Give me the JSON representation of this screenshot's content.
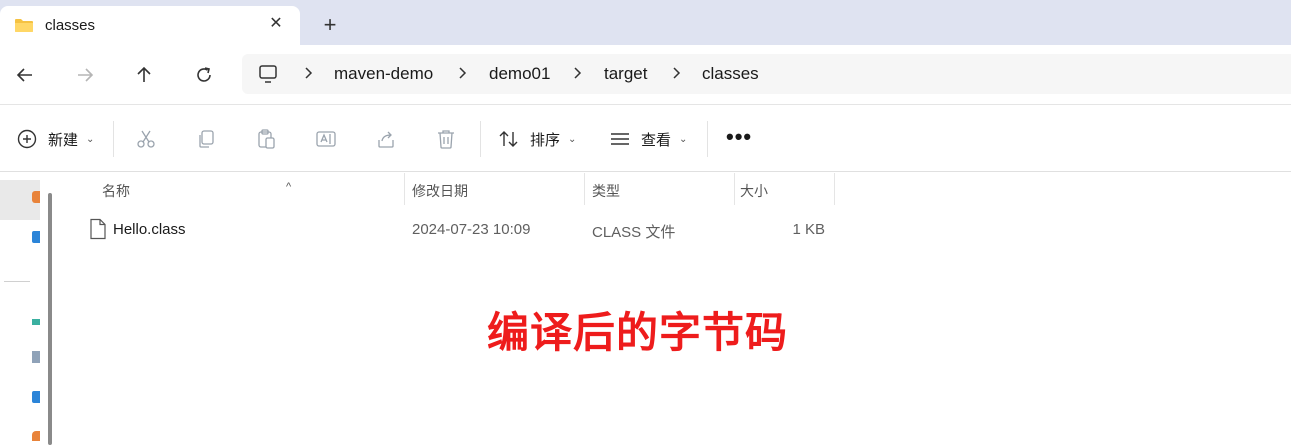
{
  "tab": {
    "title": "classes",
    "close_glyph": "✕",
    "new_tab_glyph": "+"
  },
  "nav": {
    "breadcrumb": [
      "maven-demo",
      "demo01",
      "target",
      "classes"
    ]
  },
  "toolbar": {
    "new_label": "新建",
    "sort_label": "排序",
    "view_label": "查看",
    "more_glyph": "•••",
    "chevron": "⌄"
  },
  "columns": {
    "name": "名称",
    "modified": "修改日期",
    "type": "类型",
    "size": "大小",
    "sort_glyph": "^"
  },
  "files": [
    {
      "name": "Hello.class",
      "modified": "2024-07-23 10:09",
      "type": "CLASS 文件",
      "size": "1 KB"
    }
  ],
  "annotation": "编译后的字节码",
  "colors": {
    "annotation": "#ee1c1c",
    "folder": "#f5c242",
    "tabbar": "#dfe3f1"
  }
}
